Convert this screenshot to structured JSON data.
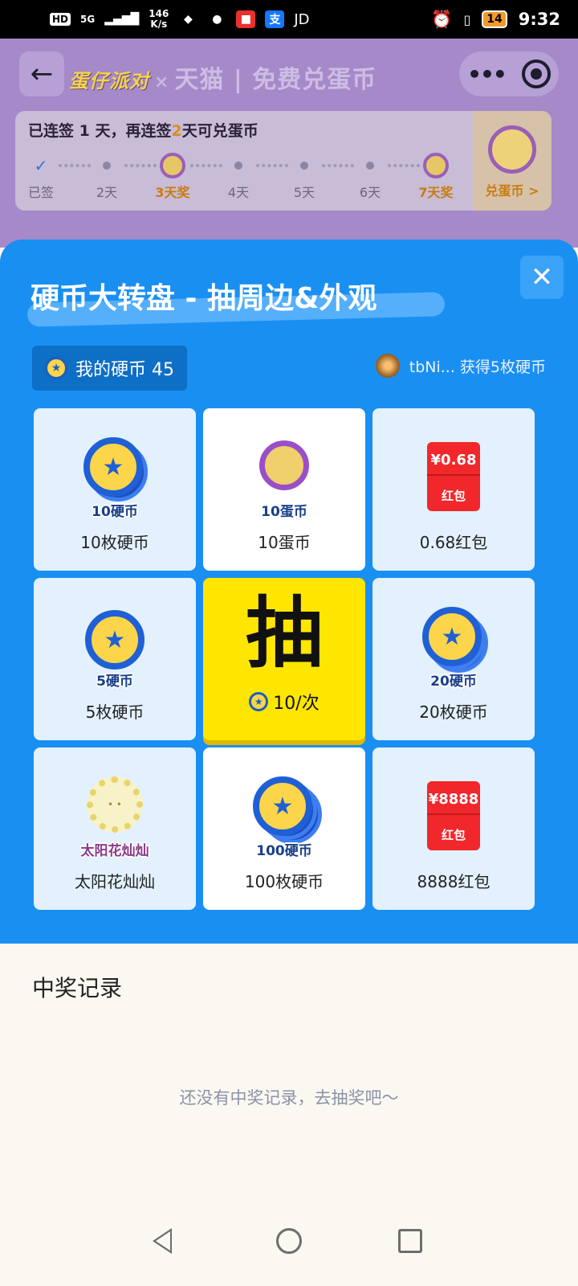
{
  "status_bar": {
    "hd": "HD",
    "network": "5G",
    "speed_value": "146",
    "speed_unit": "K/s",
    "app_icons": [
      "qq-icon",
      "wechat-icon",
      "app-icon",
      "alipay-icon"
    ],
    "alipay_glyph": "支",
    "jd": "JD",
    "battery": "14",
    "time": "9:32"
  },
  "background_page": {
    "brand_logo": "蛋仔派对",
    "brand_x": "×",
    "brand_title": "天猫 | 免费兑蛋币",
    "sign_title_prefix": "已连签 1 天，再连签",
    "sign_title_highlight": "2",
    "sign_title_suffix": "天可兑蛋币",
    "days": [
      {
        "label": "已签",
        "type": "check"
      },
      {
        "label": "2天",
        "type": "dot"
      },
      {
        "label": "3天奖",
        "type": "medal"
      },
      {
        "label": "4天",
        "type": "dot"
      },
      {
        "label": "5天",
        "type": "dot"
      },
      {
        "label": "6天",
        "type": "dot"
      },
      {
        "label": "7天奖",
        "type": "medal"
      }
    ],
    "exchange_label": "兑蛋币 >"
  },
  "modal": {
    "title": "硬币大转盘 - 抽周边&外观",
    "close_glyph": "✕",
    "my_coins_label": "我的硬币 45",
    "winner_text": "tbNi... 获得5枚硬币",
    "star_glyph": "★",
    "prizes": [
      {
        "name": "10枚硬币",
        "badge": "10硬币"
      },
      {
        "name": "10蛋币",
        "badge": "10蛋币"
      },
      {
        "name": "0.68红包",
        "amount": "¥0.68",
        "packet": "红包"
      },
      {
        "name": "5枚硬币",
        "badge": "5硬币"
      },
      {
        "name": "20枚硬币",
        "badge": "20硬币"
      },
      {
        "name": "太阳花灿灿",
        "badge": "太阳花灿灿"
      },
      {
        "name": "100枚硬币",
        "badge": "100硬币"
      },
      {
        "name": "8888红包",
        "amount": "¥8888",
        "packet": "红包"
      }
    ],
    "draw_char": "抽",
    "draw_cost": "10/次"
  },
  "records": {
    "title": "中奖记录",
    "empty_text": "还没有中奖记录，去抽奖吧～"
  },
  "colors": {
    "modal_blue": "#1a8ff2",
    "draw_yellow": "#ffe600",
    "red_packet": "#f2272b",
    "gold_text": "#c97b10"
  }
}
